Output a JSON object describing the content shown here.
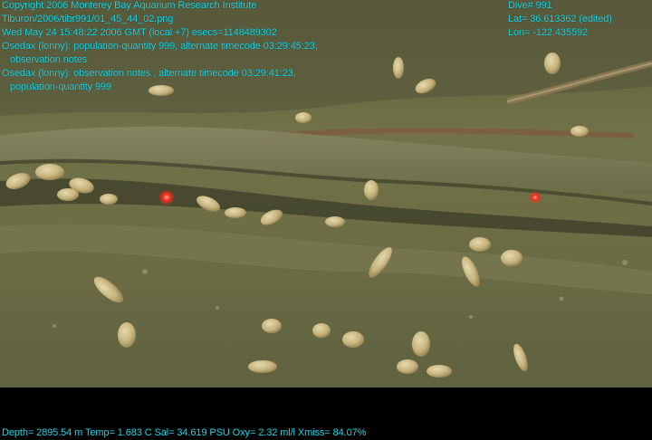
{
  "overlay": {
    "copyright": "Copyright 2006 Monterey Bay Aquarium Research Institute",
    "path": "Tiburon/2006/tibr991/01_45_44_02.png",
    "datetime": "Wed May 24 15:48:22 2006 GMT (local +7)  esecs=1148489302",
    "annotation1_line1": "Osedax (lonny): population-quantity 999, alternate timecode 03:29:45:23,",
    "annotation1_line2": "observation notes",
    "annotation2_line1": "Osedax (lonny): observation notes , alternate timecode 03:29:41:23,",
    "annotation2_line2": "population-quantity 999",
    "dive": "Dive# 991",
    "lat": "Lat= 36.613362 (edited)",
    "lon": "Lon= -122.435592",
    "telemetry": "Depth= 2895.54 m  Temp= 1.683 C  Sal= 34.619 PSU  Oxy= 2.32 ml/l  Xmiss= 84.07%"
  },
  "colors": {
    "overlay_text": "#19d8e8",
    "sediment": "#6d6e46",
    "background": "#000000",
    "laser": "#ff2a1a"
  }
}
